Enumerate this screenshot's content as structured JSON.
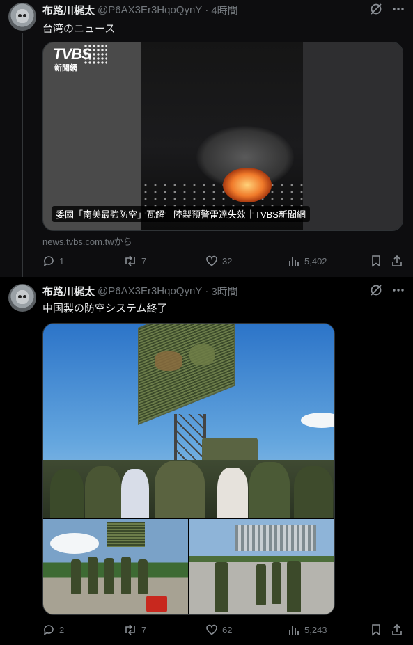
{
  "tweets": [
    {
      "name": "布路川梶太",
      "handle": "@P6AX3Er3HqoQynY",
      "separator": "·",
      "time": "4時間",
      "text": "台湾のニュース",
      "card": {
        "logo": "TVBS",
        "logo_sub": "新聞網",
        "title": "委國「南美最強防空」瓦解　陸製預警雷達失效｜TVBS新聞網",
        "domain": "news.tvbs.com.twから"
      },
      "stats": {
        "replies": "1",
        "retweets": "7",
        "likes": "32",
        "views": "5,402"
      }
    },
    {
      "name": "布路川梶太",
      "handle": "@P6AX3Er3HqoQynY",
      "separator": "·",
      "time": "3時間",
      "text": "中国製の防空システム終了",
      "stats": {
        "replies": "2",
        "retweets": "7",
        "likes": "62",
        "views": "5,243"
      }
    }
  ],
  "icons": {
    "grok": "grok-icon",
    "more": "more-icon",
    "reply": "reply-icon",
    "retweet": "retweet-icon",
    "like": "heart-icon",
    "views": "views-icon",
    "bookmark": "bookmark-icon",
    "share": "share-icon"
  },
  "colors": {
    "background": "#000000",
    "text": "#e7e9ea",
    "muted": "#71767b",
    "border": "#2f3336"
  }
}
